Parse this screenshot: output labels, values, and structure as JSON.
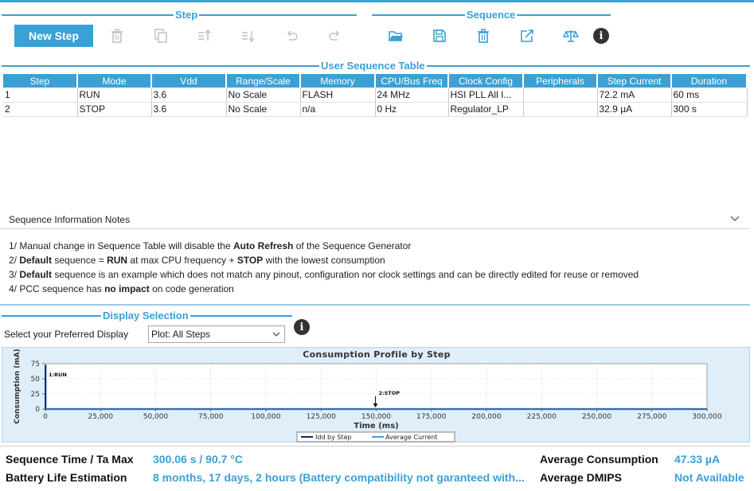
{
  "step_section": {
    "title": "Step",
    "new_step_label": "New Step"
  },
  "sequence_section": {
    "title": "Sequence"
  },
  "table_section": {
    "title": "User Sequence Table"
  },
  "table": {
    "headers": [
      "Step",
      "Mode",
      "Vdd",
      "Range/Scale",
      "Memory",
      "CPU/Bus Freq",
      "Clock Config",
      "Peripherals",
      "Step Current",
      "Duration"
    ],
    "rows": [
      [
        "1",
        "RUN",
        "3.6",
        "No Scale",
        "FLASH",
        "24 MHz",
        "HSI PLL All I...",
        "",
        "72.2 mA",
        "60 ms"
      ],
      [
        "2",
        "STOP",
        "3.6",
        "No Scale",
        "n/a",
        "0 Hz",
        "Regulator_LP",
        "",
        "32.9 µA",
        "300 s"
      ]
    ]
  },
  "notes": {
    "title": "Sequence Information Notes",
    "line1_a": "1/ Manual change in Sequence Table will disable the ",
    "line1_b": "Auto Refresh",
    "line1_c": " of the Sequence Generator",
    "line2_a": "2/ ",
    "line2_b": "Default",
    "line2_c": " sequence = ",
    "line2_d": "RUN",
    "line2_e": " at max CPU frequency + ",
    "line2_f": "STOP",
    "line2_g": " with the lowest consumption",
    "line3_a": "3/ ",
    "line3_b": "Default",
    "line3_c": " sequence is an example which does not match any pinout, configuration nor clock settings and can be directly edited for reuse or removed",
    "line4_a": "4/ PCC sequence has ",
    "line4_b": "no impact",
    "line4_c": " on code generation"
  },
  "display_section": {
    "title": "Display Selection",
    "pref_label": "Select your Preferred Display",
    "selected": "Plot: All Steps"
  },
  "chart_data": {
    "type": "line",
    "title": "Consumption Profile by Step",
    "xlabel": "Time (ms)",
    "ylabel": "Consumption (mA)",
    "xlim": [
      0,
      300000
    ],
    "ylim": [
      0,
      75
    ],
    "x_ticks": [
      "0",
      "25,000",
      "50,000",
      "75,000",
      "100,000",
      "125,000",
      "150,000",
      "175,000",
      "200,000",
      "225,000",
      "250,000",
      "275,000",
      "300,000"
    ],
    "y_ticks": [
      "0",
      "25",
      "50",
      "75"
    ],
    "series": [
      {
        "name": "Idd by Step",
        "color": "#0b2a6b",
        "points": [
          [
            0,
            72.2
          ],
          [
            60,
            72.2
          ],
          [
            60,
            0.0329
          ],
          [
            300060,
            0.0329
          ]
        ]
      },
      {
        "name": "Average Current",
        "color": "#3aa0d6",
        "points": [
          [
            0,
            0.04733
          ],
          [
            300060,
            0.04733
          ]
        ]
      }
    ],
    "annotations": [
      {
        "text": "1:RUN",
        "x": 0,
        "y": 72.2
      },
      {
        "text": "2:STOP",
        "x": 150000,
        "y": 0.0329
      }
    ],
    "legend_position": "bottom"
  },
  "stats": {
    "seq_time_label": "Sequence Time / Ta Max",
    "seq_time_value": "300.06 s / 90.7 °C",
    "battery_label": "Battery Life Estimation",
    "battery_value": "8 months, 17 days, 2 hours (Battery compatibility not garanteed with...",
    "avg_cons_label": "Average Consumption",
    "avg_cons_value": "47.33 µA",
    "avg_dmips_label": "Average DMIPS",
    "avg_dmips_value": "Not Available"
  },
  "colors": {
    "accent": "#3aa0d6",
    "series_idd": "#0b2a6b",
    "plot_bg": "#dfeef8"
  }
}
